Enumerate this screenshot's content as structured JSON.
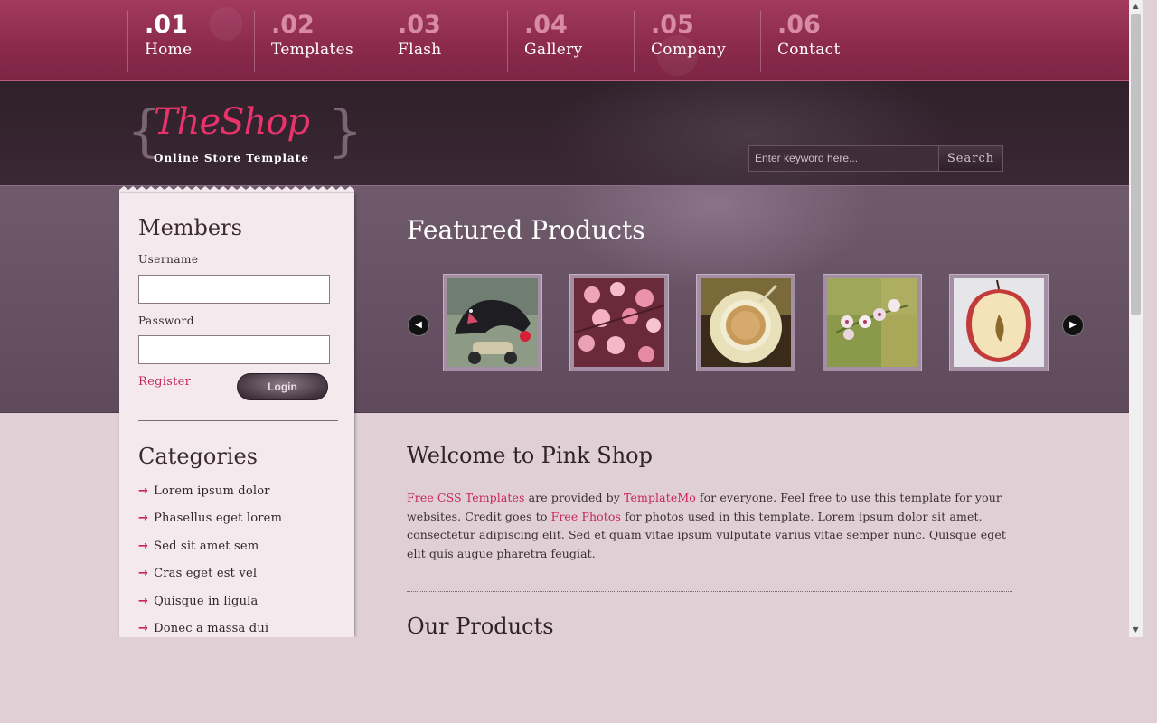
{
  "nav": {
    "items": [
      {
        "num": ".01",
        "label": "Home",
        "active": true
      },
      {
        "num": ".02",
        "label": "Templates"
      },
      {
        "num": ".03",
        "label": "Flash"
      },
      {
        "num": ".04",
        "label": "Gallery"
      },
      {
        "num": ".05",
        "label": "Company"
      },
      {
        "num": ".06",
        "label": "Contact"
      }
    ]
  },
  "header": {
    "logo_title": "TheShop",
    "logo_subtitle": "Online Store Template",
    "search_placeholder": "Enter keyword here...",
    "search_button": "Search"
  },
  "featured": {
    "title": "Featured Products",
    "prev_icon": "arrow-left-icon",
    "next_icon": "arrow-right-icon",
    "thumbnails": [
      "panther-scooter",
      "pink-blossoms",
      "coffee-cup",
      "orchid-flowers",
      "apple-half"
    ]
  },
  "sidebar": {
    "members_title": "Members",
    "username_label": "Username",
    "password_label": "Password",
    "register_label": "Register",
    "login_label": "Login",
    "categories_title": "Categories",
    "categories": [
      "Lorem ipsum dolor",
      "Phasellus eget lorem",
      "Sed sit amet sem",
      "Cras eget est vel",
      "Quisque in ligula",
      "Donec a massa dui"
    ]
  },
  "main": {
    "welcome_title": "Welcome to Pink Shop",
    "welcome_link1": "Free CSS Templates",
    "welcome_t1": " are provided by ",
    "welcome_link2": "TemplateMo",
    "welcome_t2": " for everyone. Feel free to use this template for your websites. Credit goes to ",
    "welcome_link3": "Free Photos",
    "welcome_t3": " for photos used in this template. Lorem ipsum dolor sit amet, consectetur adipiscing elit. Sed et quam vitae ipsum vulputate varius vitae semper nunc. Quisque eget elit quis augue pharetra feugiat.",
    "products_title": "Our Products"
  },
  "colors": {
    "accent": "#c8245c",
    "nav_bg": "#8b2a4c",
    "header_bg": "#2f2029",
    "band_bg": "#6a5567",
    "page_bg": "#e0d0d6"
  }
}
